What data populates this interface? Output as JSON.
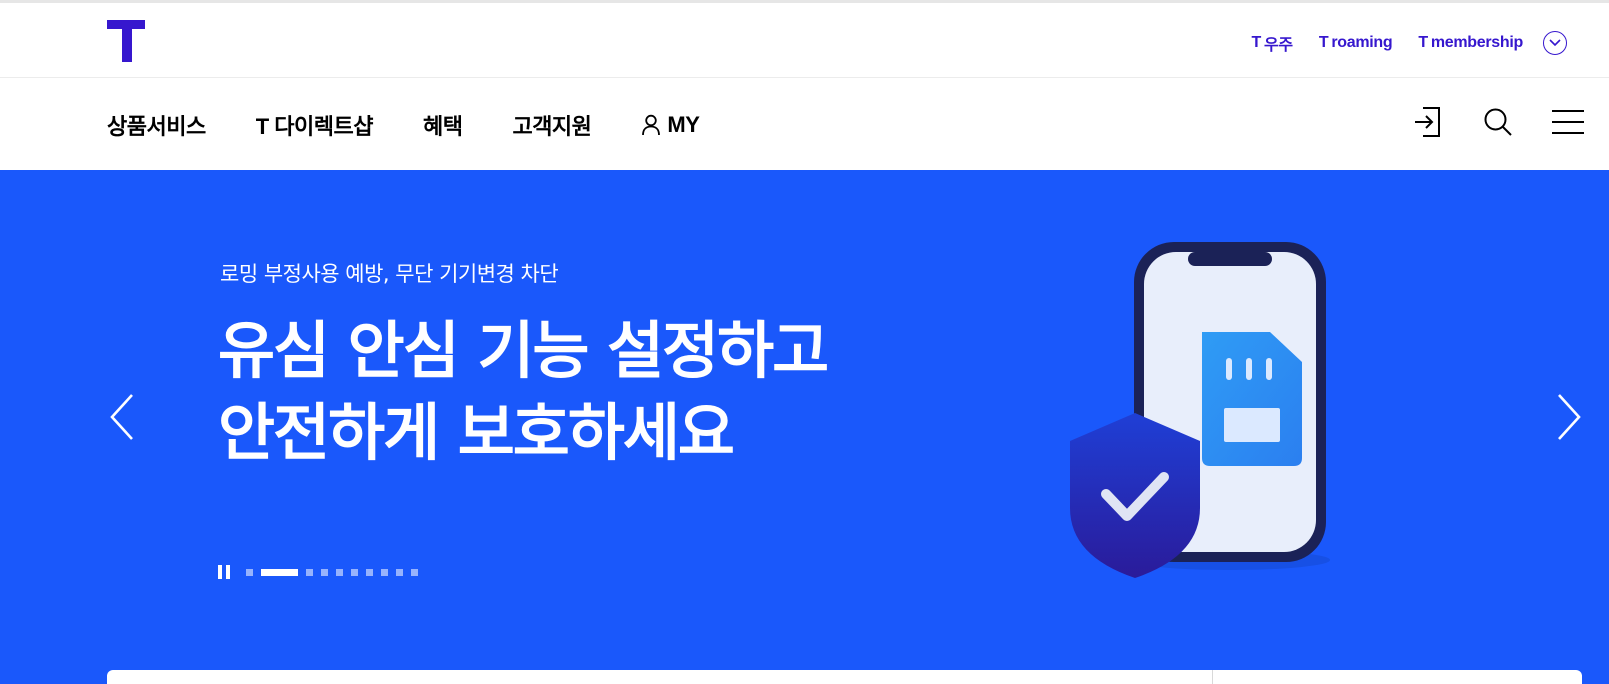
{
  "brand": {
    "logo_alt": "T",
    "accent": "#3617ce"
  },
  "utility_links": [
    {
      "mark": "T",
      "label": "우주"
    },
    {
      "mark": "T",
      "label": "roaming"
    },
    {
      "mark": "T",
      "label": "membership"
    }
  ],
  "nav": {
    "items": [
      "상품서비스",
      "T 다이렉트샵",
      "혜택",
      "고객지원"
    ],
    "my_label": "MY"
  },
  "nav_icons": [
    "login-icon",
    "search-icon",
    "menu-icon"
  ],
  "hero": {
    "background": "#1a58fb",
    "subtitle": "로밍 부정사용 예방, 무단 기기변경 차단",
    "title_line1": "유심 안심 기능 설정하고",
    "title_line2": "안전하게 보호하세요",
    "slide_count": 10,
    "active_slide": 2
  }
}
